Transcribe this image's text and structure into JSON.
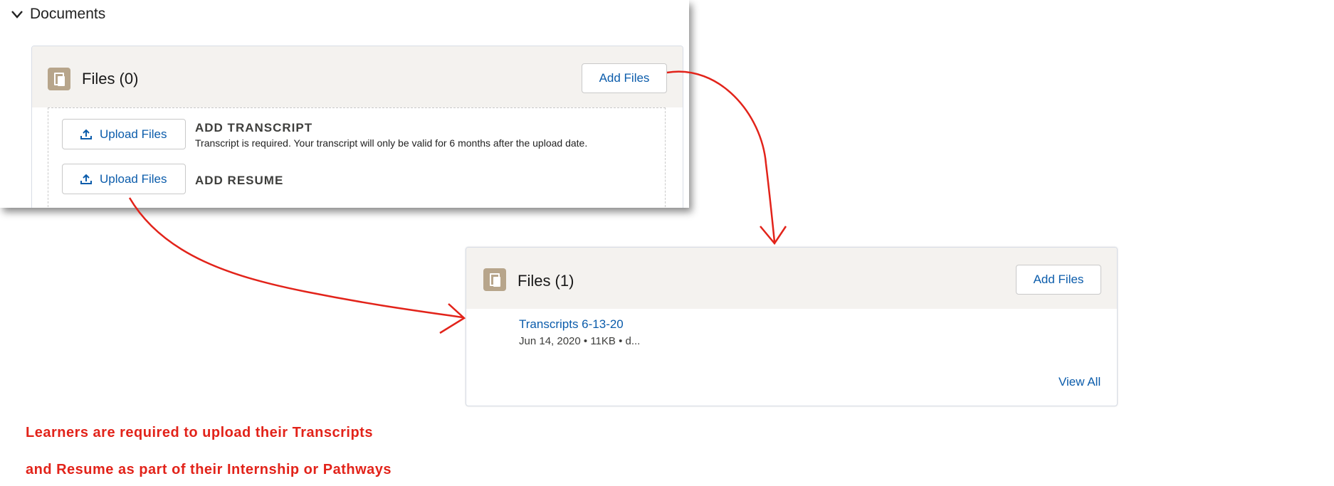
{
  "top": {
    "section_label": "Documents",
    "card_title": "Files (0)",
    "add_files_label": "Add Files",
    "transcript": {
      "upload_label": "Upload Files",
      "heading": "ADD TRANSCRIPT",
      "description": "Transcript is required. Your transcript will only be valid for 6 months after the upload date."
    },
    "resume": {
      "upload_label": "Upload Files",
      "heading": "ADD RESUME"
    }
  },
  "bottom": {
    "card_title": "Files (1)",
    "add_files_label": "Add Files",
    "file": {
      "name": "Transcripts 6-13-20",
      "meta": "Jun 14, 2020 • 11KB • d..."
    },
    "view_all_label": "View All"
  },
  "annotation": {
    "line1": "Learners are required to upload their Transcripts",
    "line2": "and Resume as part of their Internship or Pathways"
  },
  "colors": {
    "link": "#0b5cab",
    "annotation_red": "#e2231a",
    "file_icon_bg": "#b7a58b",
    "card_header_bg": "#f4f2ef"
  },
  "icons": [
    "chevron-down-icon",
    "file-icon",
    "upload-icon"
  ]
}
